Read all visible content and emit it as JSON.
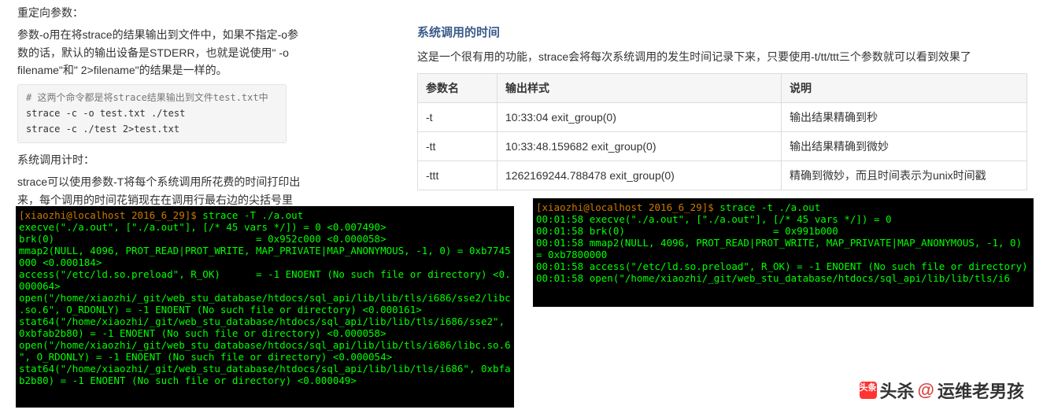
{
  "left": {
    "h1": "重定向参数：",
    "p1": "参数-o用在将strace的结果输出到文件中，如果不指定-o参数的话，默认的输出设备是STDERR，也就是说使用\" -o filename\"和\" 2>filename\"的结果是一样的。",
    "code_cmt": "# 这两个命令都是将strace结果输出到文件test.txt中",
    "code_l1": "strace -c -o test.txt ./test",
    "code_l2": "strace -c ./test  2>test.txt",
    "h2": "系统调用计时：",
    "p2": "strace可以使用参数-T将每个系统调用所花费的时间打印出来，每个调用的时间花销现在在调用行最右边的尖括号里面。"
  },
  "right": {
    "title": "系统调用的时间",
    "intro": "这是一个很有用的功能，strace会将每次系统调用的发生时间记录下来，只要使用-t/tt/ttt三个参数就可以看到效果了",
    "th1": "参数名",
    "th2": "输出样式",
    "th3": "说明",
    "rows": [
      {
        "a": "-t",
        "b": "10:33:04 exit_group(0)",
        "c": "输出结果精确到秒"
      },
      {
        "a": "-tt",
        "b": "10:33:48.159682 exit_group(0)",
        "c": "输出结果精确到微妙"
      },
      {
        "a": "-ttt",
        "b": "1262169244.788478 exit_group(0)",
        "c": "精确到微妙，而且时间表示为unix时间戳"
      }
    ]
  },
  "termL": {
    "l0a": "[xiaozhi@localhost 2016_6_29]$ ",
    "l0b": "strace -T ./a.out",
    "l1": "execve(\"./a.out\", [\"./a.out\"], [/* 45 vars */]) = 0 <0.007490>",
    "l2": "brk(0)                                  = 0x952c000 <0.000058>",
    "l3": "mmap2(NULL, 4096, PROT_READ|PROT_WRITE, MAP_PRIVATE|MAP_ANONYMOUS, -1, 0) = 0xb7745000 <0.000184>",
    "l4": "access(\"/etc/ld.so.preload\", R_OK)      = -1 ENOENT (No such file or directory) <0.000064>",
    "l5": "open(\"/home/xiaozhi/_git/web_stu_database/htdocs/sql_api/lib/lib/tls/i686/sse2/libc.so.6\", O_RDONLY) = -1 ENOENT (No such file or directory) <0.000161>",
    "l6": "stat64(\"/home/xiaozhi/_git/web_stu_database/htdocs/sql_api/lib/lib/tls/i686/sse2\", 0xbfab2b80) = -1 ENOENT (No such file or directory) <0.000058>",
    "l7": "open(\"/home/xiaozhi/_git/web_stu_database/htdocs/sql_api/lib/lib/tls/i686/libc.so.6\", O_RDONLY) = -1 ENOENT (No such file or directory) <0.000054>",
    "l8": "stat64(\"/home/xiaozhi/_git/web_stu_database/htdocs/sql_api/lib/lib/tls/i686\", 0xbfab2b80) = -1 ENOENT (No such file or directory) <0.000049>"
  },
  "termR": {
    "l0a": "[xiaozhi@localhost 2016_6_29]$ ",
    "l0b": "strace -t ./a.out",
    "l1": "00:01:58 execve(\"./a.out\", [\"./a.out\"], [/* 45 vars */]) = 0",
    "l2": "00:01:58 brk(0)                         = 0x991b000",
    "l3": "00:01:58 mmap2(NULL, 4096, PROT_READ|PROT_WRITE, MAP_PRIVATE|MAP_ANONYMOUS, -1, 0) = 0xb7800000",
    "l4": "00:01:58 access(\"/etc/ld.so.preload\", R_OK) = -1 ENOENT (No such file or directory)",
    "l5": "00:01:58 open(\"/home/xiaozhi/_git/web_stu_database/htdocs/sql_api/lib/lib/tls/i6"
  },
  "watermark": {
    "brand": "头杀",
    "at": "@",
    "name": "运维老男孩"
  }
}
